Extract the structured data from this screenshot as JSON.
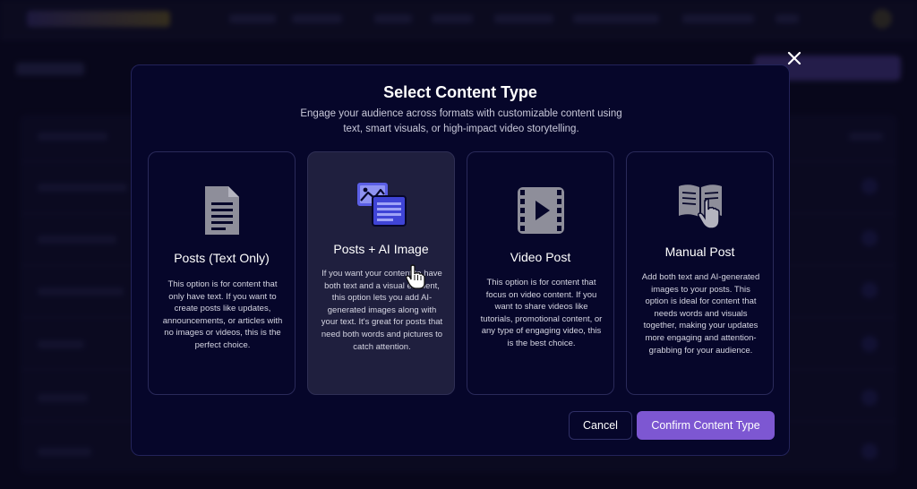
{
  "modal": {
    "title": "Select Content Type",
    "description": "Engage your audience across formats with customizable content using text, smart visuals, or high-impact video storytelling.",
    "close_icon": "close-icon",
    "cards": [
      {
        "title": "Posts (Text Only)",
        "icon": "document-icon",
        "description": "This option is for content that only have text. If you want to create posts like updates, announcements, or articles with no images or videos, this is the perfect choice.",
        "selected": false
      },
      {
        "title": "Posts + AI Image",
        "icon": "image-text-icon",
        "description": "If you want your content to have both text and a visual element, this option lets you add AI-generated images along with your text. It's great for posts that need both words and pictures to catch attention.",
        "selected": true
      },
      {
        "title": "Video Post",
        "icon": "video-icon",
        "description": "This option is for content that focus on video content. If you want to share videos like tutorials, promotional content, or any type of engaging video, this is the best choice.",
        "selected": false
      },
      {
        "title": "Manual Post",
        "icon": "book-hand-icon",
        "description": "Add both text and AI-generated images to your posts. This option is ideal for content that needs words and visuals together, making your updates more engaging and attention-grabbing for your audience.",
        "selected": false
      }
    ],
    "cancel_label": "Cancel",
    "confirm_label": "Confirm Content Type"
  },
  "colors": {
    "modal_bg": "#06062a",
    "selected_card_bg": "#1f1f3e",
    "accent": "#7d57d2",
    "icon_gray": "#8e8e9a",
    "icon_blue": "#5b5fe6"
  }
}
